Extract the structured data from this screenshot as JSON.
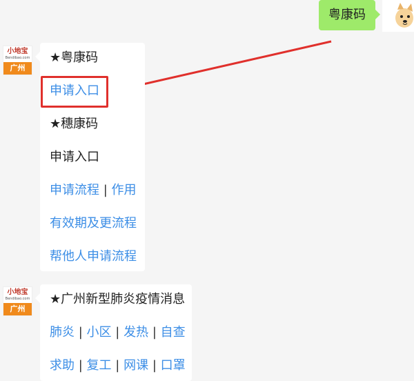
{
  "sent_message": {
    "text": "粤康码"
  },
  "bot": {
    "brand": "小地宝",
    "site": "Bendibao.com",
    "city": "广州"
  },
  "message1": {
    "lines": [
      {
        "text": "★粤康码"
      },
      {
        "text": "申请入口"
      },
      {
        "text": "★穗康码"
      },
      {
        "text": "申请入口"
      },
      {
        "parts": [
          "申请流程",
          "|",
          "作用"
        ]
      },
      {
        "text": "有效期及更流程"
      },
      {
        "text": "帮他人申请流程"
      }
    ]
  },
  "message2": {
    "title": "★广州新型肺炎疫情消息",
    "row1": [
      "肺炎",
      "|",
      "小区",
      "|",
      "发热",
      "|",
      "自查"
    ],
    "row2": [
      "求助",
      "|",
      "复工",
      "|",
      "网课",
      "|",
      "口罩"
    ]
  },
  "colors": {
    "link": "#3c8ee6",
    "sent_bubble": "#9eea6a",
    "highlight": "#e0302c",
    "city_badge": "#f08a1c"
  },
  "icons": {
    "arrow": "red-arrow-icon",
    "user_avatar": "cartoon-dog-avatar-icon"
  }
}
